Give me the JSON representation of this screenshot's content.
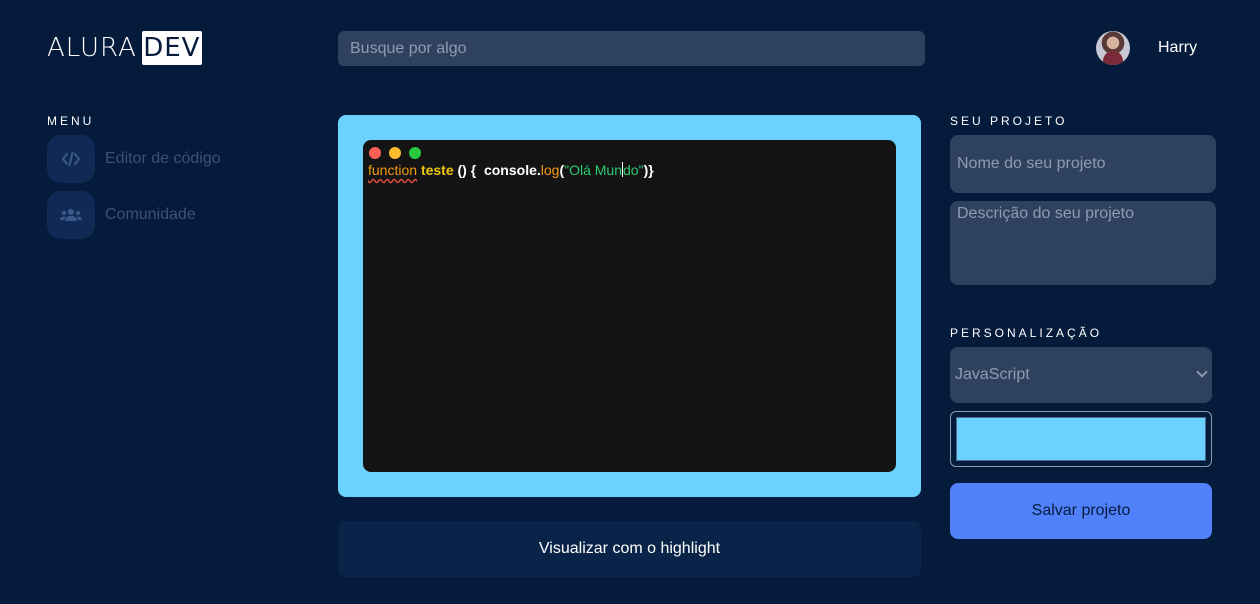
{
  "header": {
    "logo_text": "ALURA",
    "logo_badge": "DEV",
    "search_placeholder": "Busque por algo",
    "user_name": "Harry"
  },
  "menu": {
    "title": "MENU",
    "items": [
      {
        "label": "Editor de código",
        "icon": "code-icon"
      },
      {
        "label": "Comunidade",
        "icon": "users-icon"
      }
    ]
  },
  "editor": {
    "background_color": "#6bd1ff",
    "code": {
      "keyword": "function",
      "function_name": "teste",
      "parens_brace": "() {",
      "object": "console.",
      "method": "log",
      "open_paren": "(",
      "string_start": "\"Olá Mun",
      "string_end": "do\"",
      "close": ")}"
    },
    "highlight_button": "Visualizar com o highlight"
  },
  "project": {
    "title": "SEU PROJETO",
    "name_placeholder": "Nome do seu projeto",
    "description_placeholder": "Descrição do seu projeto"
  },
  "customization": {
    "title": "PERSONALIZAÇÃO",
    "language_selected": "JavaScript",
    "color_value": "#6bd1ff",
    "save_button": "Salvar projeto"
  },
  "colors": {
    "background": "#051b3c",
    "accent": "#5081fb",
    "input_bg": "#2e4260"
  }
}
